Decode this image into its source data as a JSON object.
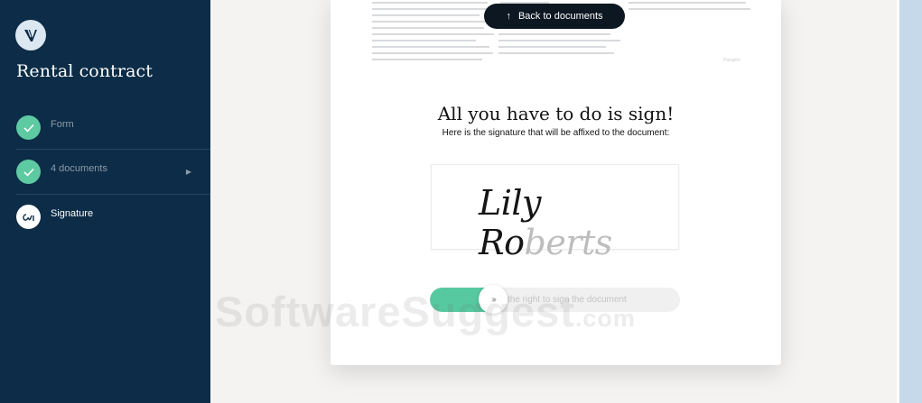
{
  "sidebar": {
    "title": "Rental contract",
    "steps": [
      {
        "label": "Form"
      },
      {
        "label": "4 documents"
      },
      {
        "label": "Signature"
      }
    ]
  },
  "card": {
    "back_label": "Back to documents",
    "headline": "All you have to do is sign!",
    "subline": "Here is the signature that will be affixed to the document:",
    "signature_part1": "Lily Ro",
    "signature_part2": "berts",
    "slider_label": "the right to sign the document",
    "preview_note": "Paraphe"
  },
  "watermark": {
    "main": "SoftwareSuggest",
    "suffix": ".com"
  },
  "colors": {
    "sidebar": "#0c2c47",
    "accent": "#57c9a0",
    "button": "#0d1721"
  }
}
